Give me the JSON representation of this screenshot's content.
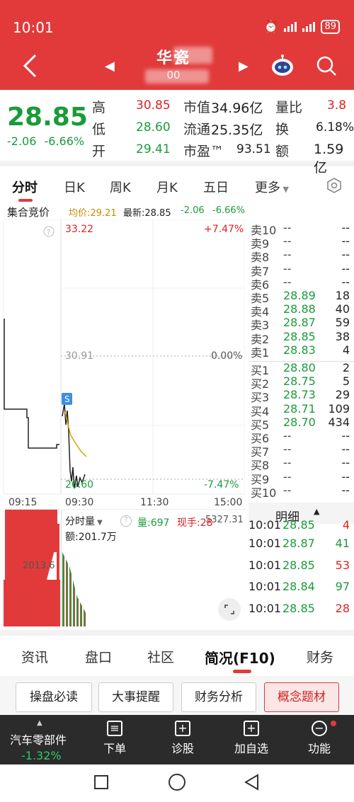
{
  "status_bar": {
    "time": "10:01",
    "battery": "89"
  },
  "header": {
    "name": "华瓷",
    "code": "00"
  },
  "quote": {
    "price": "28.85",
    "change": "-2.06",
    "change_pct": "-6.66%",
    "stats": [
      {
        "label": "高",
        "value": "30.85"
      },
      {
        "label": "低",
        "value": "28.60"
      },
      {
        "label": "开",
        "value": "29.41"
      },
      {
        "label": "市值",
        "value": "34.96亿"
      },
      {
        "label": "流通",
        "value": "25.35亿"
      },
      {
        "label": "市盈™",
        "value": "93.51"
      },
      {
        "label": "量比",
        "value": "3.8"
      },
      {
        "label": "换",
        "value": "6.18%"
      },
      {
        "label": "额",
        "value": "1.59亿"
      }
    ]
  },
  "tabs": [
    "分时",
    "日K",
    "周K",
    "月K",
    "五日",
    "更多"
  ],
  "info_row": {
    "auction": "集合竞价",
    "avg_label": "均价:29.21",
    "latest_label": "最新:28.85",
    "change": "-2.06",
    "change_pct": "-6.66%"
  },
  "chart": {
    "price_high": "33.22",
    "price_mid": "30.91",
    "price_low": "26.60",
    "pct_high": "+7.47%",
    "pct_mid": "0.00%",
    "pct_low": "-7.47%",
    "times": [
      "09:15",
      "09:30",
      "11:30",
      "15:00"
    ],
    "marker": "S",
    "volume_label": "分时量",
    "volume_value": "量:697",
    "hand_value": "现手:28",
    "amount_value": "额:201.7万",
    "vol_right": "5327.31",
    "vol_left": "2013.6"
  },
  "orderbook": {
    "asks": [
      {
        "label": "卖10",
        "price": "--",
        "vol": "--"
      },
      {
        "label": "卖9",
        "price": "--",
        "vol": "--"
      },
      {
        "label": "卖8",
        "price": "--",
        "vol": "--"
      },
      {
        "label": "卖7",
        "price": "--",
        "vol": "--"
      },
      {
        "label": "卖6",
        "price": "--",
        "vol": "--"
      },
      {
        "label": "卖5",
        "price": "28.89",
        "vol": "18"
      },
      {
        "label": "卖4",
        "price": "28.88",
        "vol": "40"
      },
      {
        "label": "卖3",
        "price": "28.87",
        "vol": "59"
      },
      {
        "label": "卖2",
        "price": "28.85",
        "vol": "38"
      },
      {
        "label": "卖1",
        "price": "28.83",
        "vol": "4"
      }
    ],
    "bids": [
      {
        "label": "买1",
        "price": "28.80",
        "vol": "2"
      },
      {
        "label": "买2",
        "price": "28.75",
        "vol": "5"
      },
      {
        "label": "买3",
        "price": "28.73",
        "vol": "29"
      },
      {
        "label": "买4",
        "price": "28.71",
        "vol": "109"
      },
      {
        "label": "买5",
        "price": "28.70",
        "vol": "434"
      },
      {
        "label": "买6",
        "price": "--",
        "vol": "--"
      },
      {
        "label": "买7",
        "price": "--",
        "vol": "--"
      },
      {
        "label": "买8",
        "price": "--",
        "vol": "--"
      },
      {
        "label": "买9",
        "price": "--",
        "vol": "--"
      },
      {
        "label": "买10",
        "price": "--",
        "vol": "--"
      }
    ]
  },
  "detail": {
    "title": "明细",
    "trades": [
      {
        "time": "10:01",
        "price": "28.85",
        "vol": "4"
      },
      {
        "time": "10:01",
        "price": "28.87",
        "vol": "41"
      },
      {
        "time": "10:01",
        "price": "28.85",
        "vol": "53"
      },
      {
        "time": "10:01",
        "price": "28.84",
        "vol": "97"
      },
      {
        "time": "10:01",
        "price": "28.85",
        "vol": "28"
      }
    ]
  },
  "bottom_tabs": [
    "资讯",
    "盘口",
    "社区",
    "简况(F10)",
    "财务"
  ],
  "sub_buttons": [
    "操盘必读",
    "大事提醒",
    "财务分析",
    "概念题材"
  ],
  "toolbar": {
    "sector_name": "汽车零部件",
    "sector_change": "-1.32%",
    "items": [
      "下单",
      "诊股",
      "加自选",
      "功能"
    ]
  },
  "colors": {
    "header_red": "#e23a3a",
    "down_green": "#1a9b3a",
    "up_red": "#d22222"
  }
}
